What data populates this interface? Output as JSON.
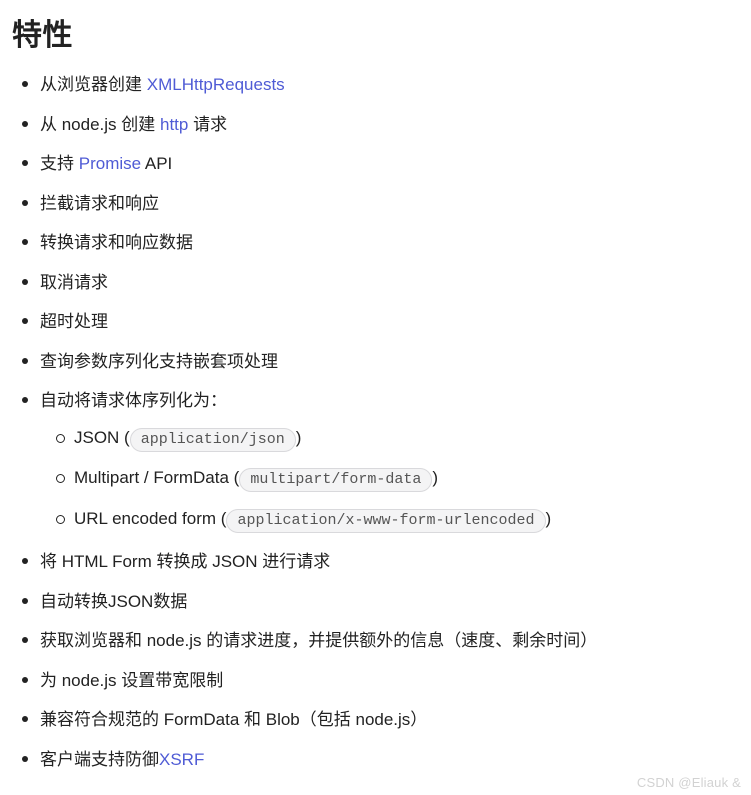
{
  "heading": "特性",
  "watermark": "CSDN @Eliauk  &",
  "items": [
    {
      "pre": "从浏览器创建 ",
      "link": "XMLHttpRequests",
      "post": ""
    },
    {
      "pre": "从 node.js 创建 ",
      "link": "http",
      "post": " 请求"
    },
    {
      "pre": "支持 ",
      "link": "Promise",
      "post": " API"
    },
    {
      "text": "拦截请求和响应"
    },
    {
      "text": "转换请求和响应数据"
    },
    {
      "text": "取消请求"
    },
    {
      "text": "超时处理"
    },
    {
      "text": "查询参数序列化支持嵌套项处理"
    },
    {
      "text": "自动将请求体序列化为：",
      "sub": [
        {
          "pre": "JSON (",
          "code": "application/json",
          "post": ")"
        },
        {
          "pre": "Multipart / FormData (",
          "code": "multipart/form-data",
          "post": ")"
        },
        {
          "pre": "URL encoded form (",
          "code": "application/x-www-form-urlencoded",
          "post": ")"
        }
      ]
    },
    {
      "text": "将 HTML Form 转换成 JSON 进行请求"
    },
    {
      "text": "自动转换JSON数据"
    },
    {
      "text": "获取浏览器和 node.js 的请求进度，并提供额外的信息（速度、剩余时间）"
    },
    {
      "text": "为 node.js 设置带宽限制"
    },
    {
      "text": "兼容符合规范的 FormData 和 Blob（包括 node.js）"
    },
    {
      "pre": "客户端支持防御",
      "link": "XSRF",
      "post": ""
    }
  ]
}
